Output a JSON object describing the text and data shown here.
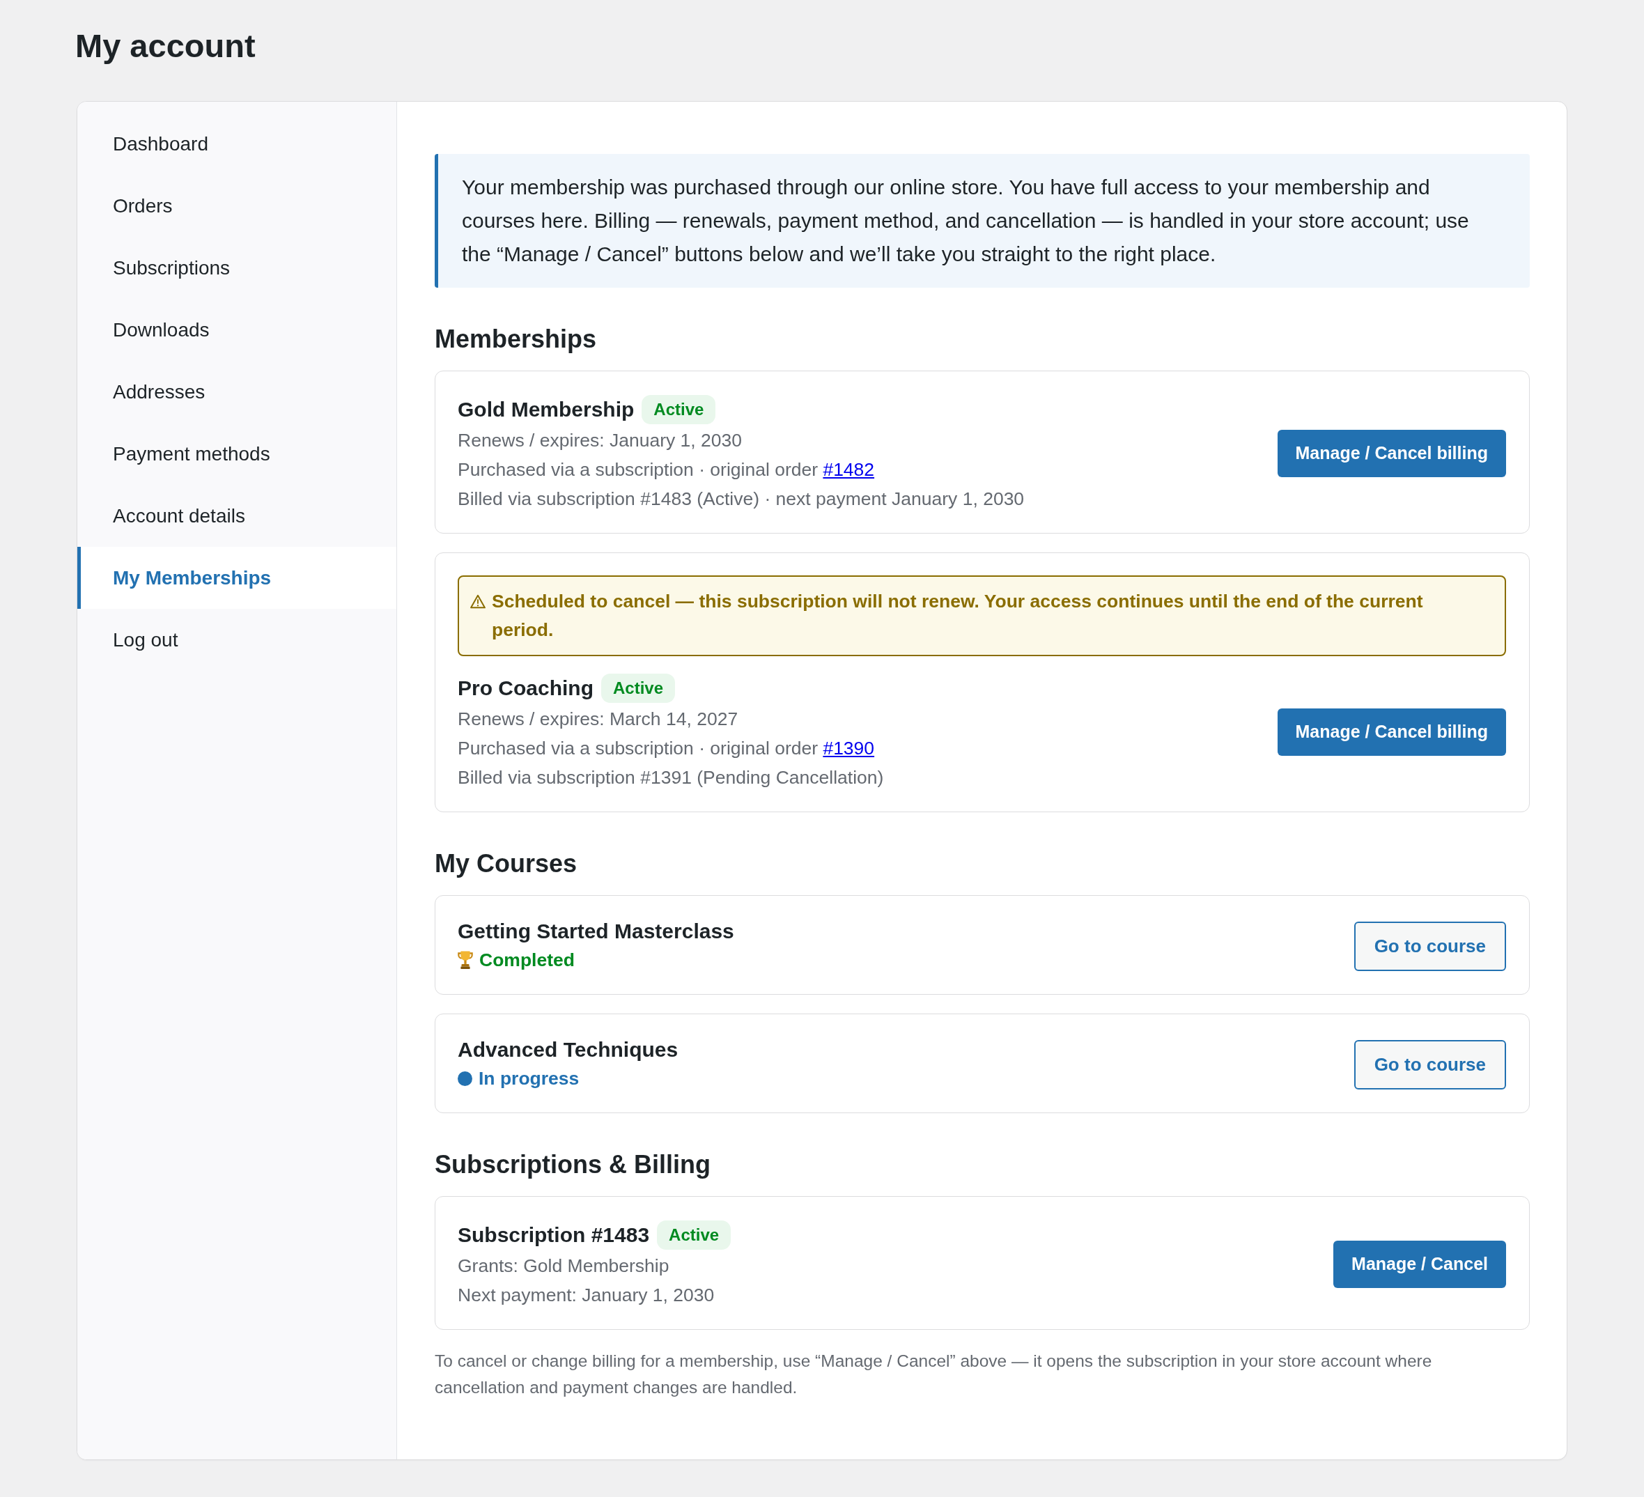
{
  "page": {
    "title": "My account"
  },
  "sidebar": {
    "items": [
      {
        "label": "Dashboard",
        "selected": false
      },
      {
        "label": "Orders",
        "selected": false
      },
      {
        "label": "Subscriptions",
        "selected": false
      },
      {
        "label": "Downloads",
        "selected": false
      },
      {
        "label": "Addresses",
        "selected": false
      },
      {
        "label": "Payment methods",
        "selected": false
      },
      {
        "label": "Account details",
        "selected": false
      },
      {
        "label": "My Memberships",
        "selected": true
      },
      {
        "label": "Log out",
        "selected": false
      }
    ]
  },
  "notice": {
    "text": "Your membership was purchased through our online store. You have full access to your membership and courses here. Billing — renewals, payment method, and cancellation — is handled in your store account; use the “Manage / Cancel” buttons below and we’ll take you straight to the right place."
  },
  "memberships": {
    "heading": "Memberships",
    "items": [
      {
        "title": "Gold Membership",
        "badge": "Active",
        "lines": [
          {
            "text": "Renews / expires: January 1, 2030"
          },
          {
            "text": "Purchased via a subscription · original order",
            "link": "#1482"
          },
          {
            "text": "Billed via subscription #1483 (Active) · next payment January 1, 2030"
          }
        ],
        "button": "Manage / Cancel billing"
      },
      {
        "warning": "Scheduled to cancel — this subscription will not renew. Your access continues until the end of the current period.",
        "title": "Pro Coaching",
        "badge": "Active",
        "lines": [
          {
            "text": "Renews / expires: March 14, 2027"
          },
          {
            "text": "Purchased via a subscription · original order",
            "link": "#1390"
          },
          {
            "text": "Billed via subscription #1391 (Pending Cancellation)"
          }
        ],
        "button": "Manage / Cancel billing"
      }
    ]
  },
  "courses": {
    "heading": "My Courses",
    "items": [
      {
        "title": "Getting Started Masterclass",
        "status": {
          "kind": "completed",
          "label": "Completed"
        },
        "button": "Go to course"
      },
      {
        "title": "Advanced Techniques",
        "status": {
          "kind": "in_progress",
          "label": "In progress"
        },
        "button": "Go to course"
      }
    ]
  },
  "billing": {
    "heading": "Subscriptions & Billing",
    "items": [
      {
        "title": "Subscription #1483",
        "badge": "Active",
        "lines": [
          {
            "text": "Grants: Gold Membership"
          },
          {
            "text": "Next payment: January 1, 2030"
          }
        ],
        "button": "Manage / Cancel"
      }
    ],
    "note": "To cancel or change billing for a membership, use “Manage / Cancel” above — it opens the subscription in your store account where cancellation and payment changes are handled."
  }
}
